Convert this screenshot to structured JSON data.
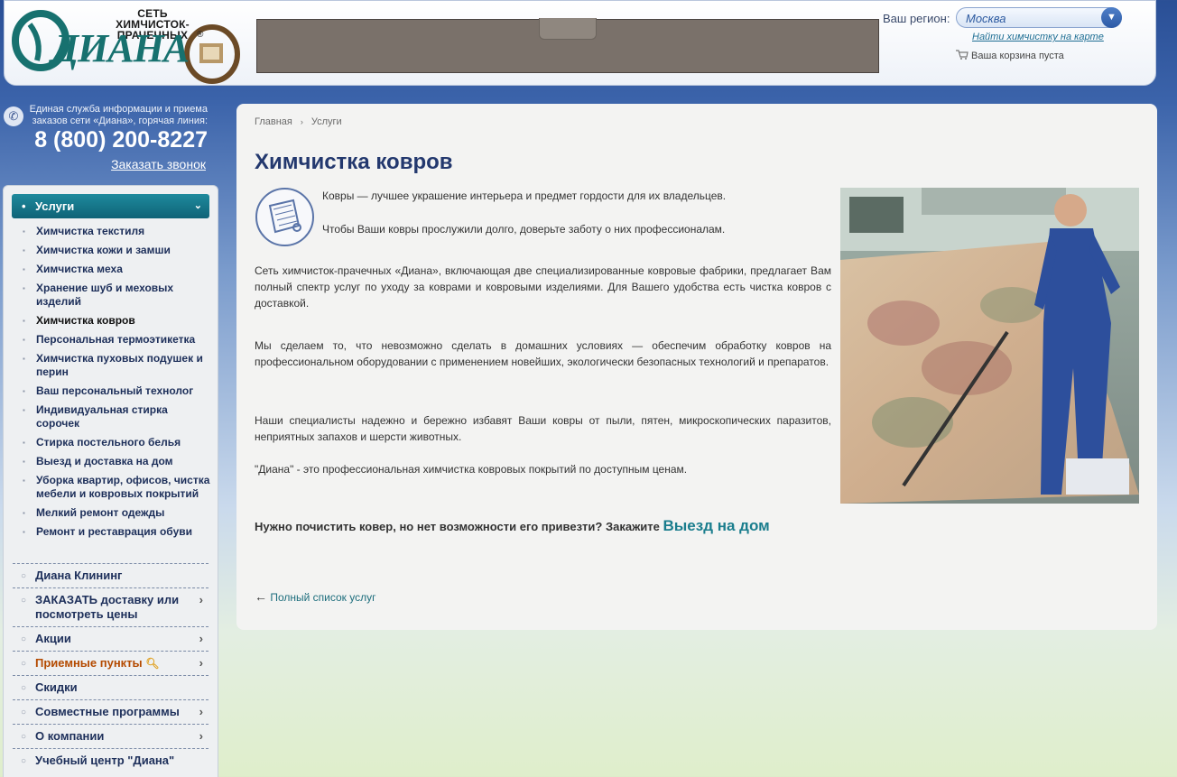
{
  "header": {
    "logo_tagline": "СЕТЬ ХИМЧИСТОК-ПРАЧЕЧНЫХ",
    "logo_text": "ДИАНА",
    "region_label": "Ваш регион:",
    "region_value": "Москва",
    "map_link": "Найти химчистку на карте",
    "cart_text": "Ваша корзина пуста"
  },
  "hotline": {
    "text": "Единая служба информации и приема заказов сети «Диана», горячая линия:",
    "phone": "8 (800) 200-8227",
    "callback": "Заказать звонок"
  },
  "sidebar": {
    "active": "Услуги",
    "sub_items": [
      "Химчистка текстиля",
      "Химчистка кожи и замши",
      "Химчистка меха",
      "Хранение шуб и меховых изделий",
      "Химчистка ковров",
      "Персональная термоэтикетка",
      "Химчистка пуховых подушек и перин",
      "Ваш персональный технолог",
      "Индивидуальная стирка сорочек",
      "Стирка постельного белья",
      "Выезд и доставка на дом",
      "Уборка квартир, офисов, чистка мебели и ковровых покрытий",
      "Мелкий ремонт одежды",
      "Ремонт и реставрация обуви"
    ],
    "current_sub": "Химчистка ковров",
    "main_items": [
      {
        "label": "Диана Клининг",
        "arrow": false
      },
      {
        "label": "ЗАКАЗАТЬ доставку или посмотреть цены",
        "arrow": true
      },
      {
        "label": "Акции",
        "arrow": true
      },
      {
        "label": "Приемные пункты",
        "arrow": true
      },
      {
        "label": "Скидки",
        "arrow": false
      },
      {
        "label": "Совместные программы",
        "arrow": true
      },
      {
        "label": "О компании",
        "arrow": true
      },
      {
        "label": "Учебный центр \"Диана\"",
        "arrow": false
      }
    ]
  },
  "breadcrumb": {
    "home": "Главная",
    "current": "Услуги"
  },
  "content": {
    "title": "Химчистка ковров",
    "intro1": "Ковры — лучшее украшение интерьера и предмет гордости для их владельцев.",
    "intro2": "Чтобы Ваши ковры прослужили долго, доверьте заботу о них профессионалам.",
    "para1": "Сеть химчисток-прачечных «Диана», включающая две специализированные ковровые фабрики, предлагает Вам полный спектр услуг по уходу за коврами и ковровыми изделиями. Для Вашего удобства есть чистка ковров с доставкой.",
    "para2": "Мы сделаем то, что невозможно сделать в домашних условиях — обеспечим обработку ковров на профессиональном оборудовании с применением новейших, экологически безопасных технологий и препаратов.",
    "para3": "Наши специалисты надежно и бережно избавят Ваши ковры от пыли, пятен, микроскопических паразитов, неприятных запахов и шерсти животных.",
    "para4": "\"Диана\" - это профессиональная химчистка ковровых покрытий  по доступным ценам.",
    "call_text": "Нужно почистить ковер, но нет возможности его привезти? Закажите",
    "call_link": "Выезд на дом",
    "back_link": "Полный список услуг"
  },
  "colors": {
    "accent_teal": "#1a7d8d",
    "title_blue": "#23386e",
    "orange_link": "#b44a00"
  }
}
